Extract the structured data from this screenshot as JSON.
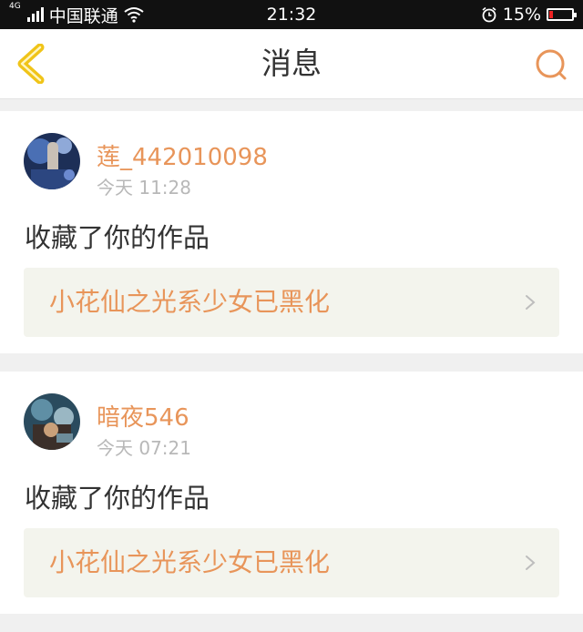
{
  "status_bar": {
    "network_type": "4G",
    "carrier": "中国联通",
    "time": "21:32",
    "battery_percent": "15%",
    "battery_level": 0.15
  },
  "header": {
    "title": "消息"
  },
  "messages": [
    {
      "username": "莲_442010098",
      "time": "今天 11:28",
      "action": "收藏了你的作品",
      "work_title": "小花仙之光系少女已黑化"
    },
    {
      "username": "暗夜546",
      "time": "今天 07:21",
      "action": "收藏了你的作品",
      "work_title": "小花仙之光系少女已黑化"
    }
  ],
  "colors": {
    "accent": "#e8955a",
    "back_icon": "#f0c418",
    "link_background": "#f3f4ed"
  }
}
